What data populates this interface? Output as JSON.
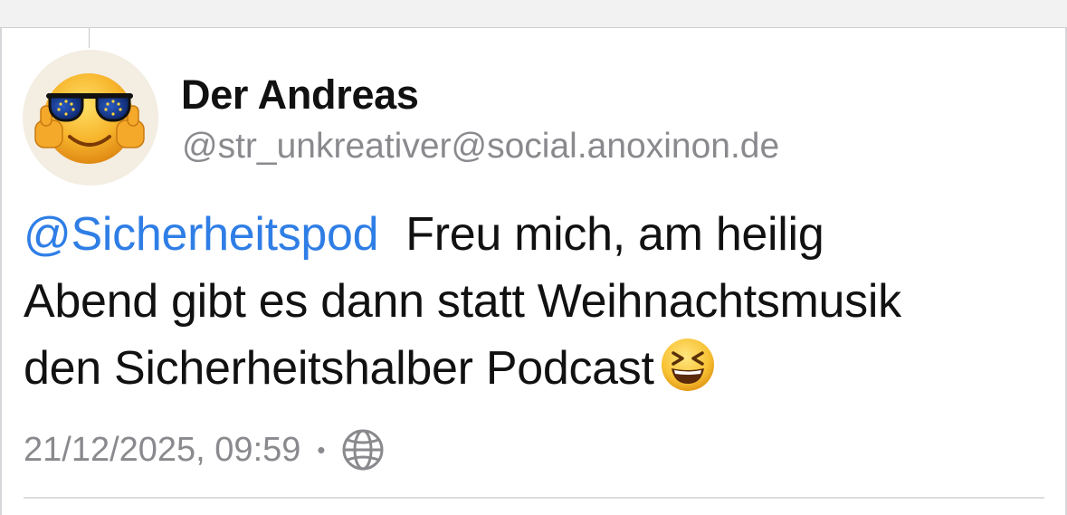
{
  "author": {
    "display_name": "Der Andreas",
    "handle": "@str_unkreativer@social.anoxinon.de",
    "avatar_icon": "sunglasses-thumbs-up-emoji"
  },
  "post": {
    "mention": "@Sicherheitspod",
    "line1_rest": "Freu mich, am heilig",
    "line2": "Abend gibt es dann statt Weihnachtsmusik",
    "line3": "den Sicherheitshalber Podcast",
    "trailing_emoji": "grinning-squinting-face-emoji"
  },
  "meta": {
    "timestamp": "21/12/2025, 09:59",
    "separator": "•",
    "visibility_icon": "globe-icon"
  },
  "colors": {
    "mention": "#2f7ee6",
    "secondary_text": "#8a8a8e",
    "primary_text": "#111111"
  }
}
